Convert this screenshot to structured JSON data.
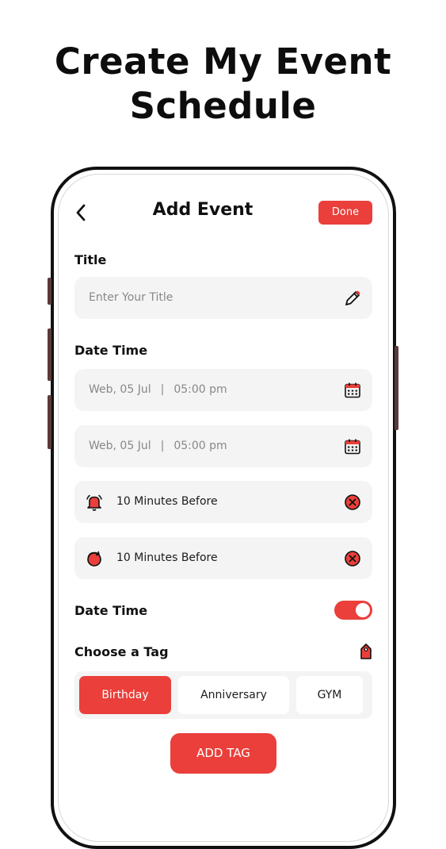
{
  "headline": {
    "line1": "Create My Event",
    "line2": "Schedule"
  },
  "nav": {
    "title": "Add Event",
    "done_label": "Done"
  },
  "title_section": {
    "label": "Title",
    "placeholder": "Enter Your Title"
  },
  "datetime_section": {
    "label": "Date Time",
    "start": {
      "date": "Web, 05 Jul",
      "separator": "|",
      "time": "05:00 pm"
    },
    "end": {
      "date": "Web, 05 Jul",
      "separator": "|",
      "time": "05:00 pm"
    },
    "reminder": "10 Minutes Before",
    "repeat": "10 Minutes Before"
  },
  "datetime_toggle": {
    "label": "Date Time",
    "enabled": true
  },
  "tag_section": {
    "label": "Choose a Tag",
    "tags": [
      {
        "label": "Birthday",
        "selected": true
      },
      {
        "label": "Anniversary",
        "selected": false
      },
      {
        "label": "GYM",
        "selected": false
      }
    ],
    "add_tag_label": "ADD TAG"
  },
  "colors": {
    "accent": "#ea3f3a",
    "field_bg": "#f4f4f4",
    "text": "#111111"
  }
}
